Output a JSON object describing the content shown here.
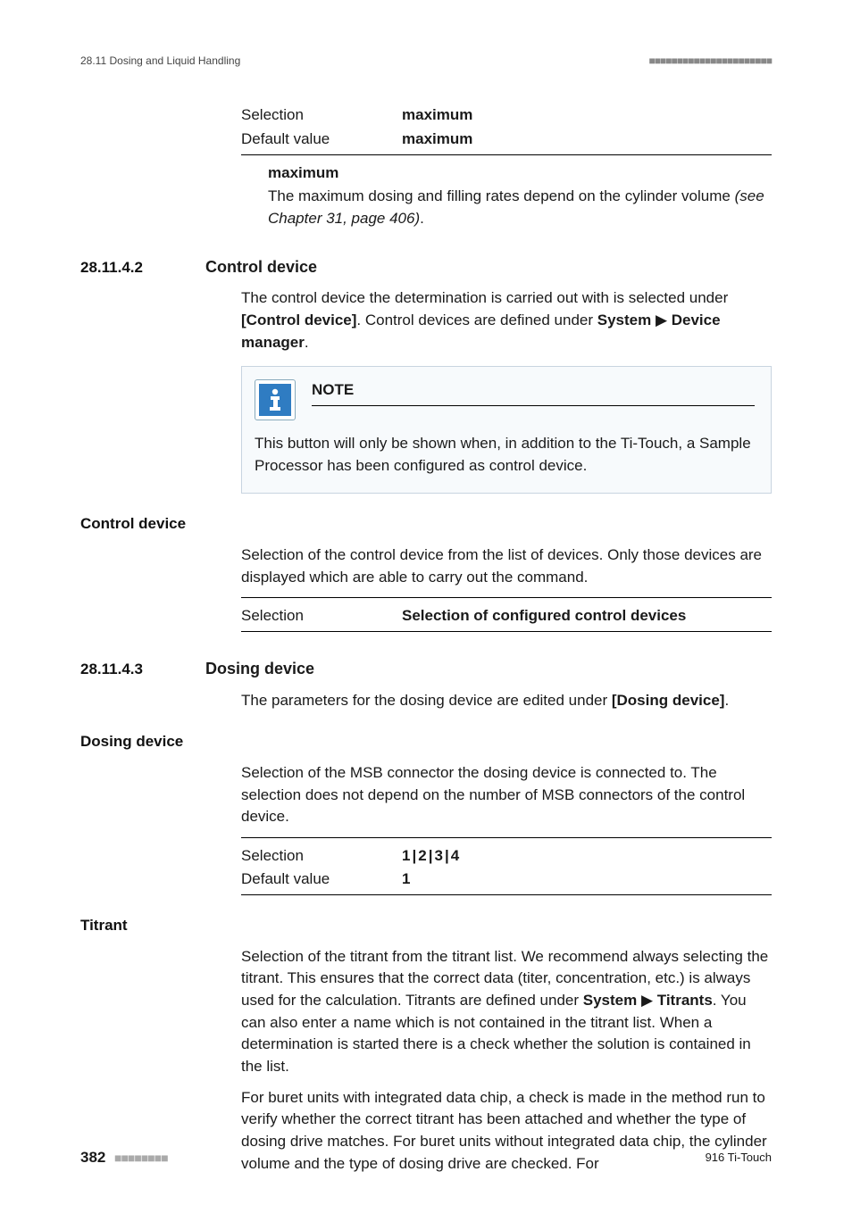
{
  "header": {
    "left": "28.11 Dosing and Liquid Handling",
    "right": "■■■■■■■■■■■■■■■■■■■■■■"
  },
  "top_kv": {
    "selection_label": "Selection",
    "selection_value": "maximum",
    "default_label": "Default value",
    "default_value": "maximum"
  },
  "maximum_term": {
    "head": "maximum",
    "body_a": "The maximum dosing and filling rates depend on the cylinder volume",
    "body_b": "(see Chapter 31, page 406)",
    "body_c": "."
  },
  "section_a": {
    "num": "28.11.4.2",
    "title": "Control device",
    "intro_a": "The control device the determination is carried out with is selected under ",
    "intro_b": "[Control device]",
    "intro_c": ". Control devices are defined under ",
    "intro_d": "System",
    "intro_e": " ▶ ",
    "intro_f": "Device manager",
    "intro_g": "."
  },
  "note": {
    "label": "NOTE",
    "text": "This button will only be shown when, in addition to the Ti-Touch, a Sample Processor has been configured as control device."
  },
  "control_device": {
    "head": "Control device",
    "body": "Selection of the control device from the list of devices. Only those devices are displayed which are able to carry out the command.",
    "sel_label": "Selection",
    "sel_value": "Selection of configured control devices"
  },
  "section_b": {
    "num": "28.11.4.3",
    "title": "Dosing device",
    "intro_a": "The parameters for the dosing device are edited under ",
    "intro_b": "[Dosing device]",
    "intro_c": "."
  },
  "dosing_device": {
    "head": "Dosing device",
    "body": "Selection of the MSB connector the dosing device is connected to. The selection does not depend on the number of MSB connectors of the control device.",
    "sel_label": "Selection",
    "sel_vals": [
      "1",
      "2",
      "3",
      "4"
    ],
    "def_label": "Default value",
    "def_value": "1"
  },
  "titrant": {
    "head": "Titrant",
    "p1_a": "Selection of the titrant from the titrant list. We recommend always selecting the titrant. This ensures that the correct data (titer, concentration, etc.) is always used for the calculation. Titrants are defined under ",
    "p1_b": "System",
    "p1_c": " ▶ ",
    "p1_d": "Titrants",
    "p1_e": ". You can also enter a name which is not contained in the titrant list. When a determination is started there is a check whether the solution is contained in the list.",
    "p2": "For buret units with integrated data chip, a check is made in the method run to verify whether the correct titrant has been attached and whether the type of dosing drive matches. For buret units without integrated data chip, the cylinder volume and the type of dosing drive are checked. For"
  },
  "footer": {
    "page": "382",
    "dashes": "■■■■■■■■",
    "device": "916 Ti-Touch"
  }
}
